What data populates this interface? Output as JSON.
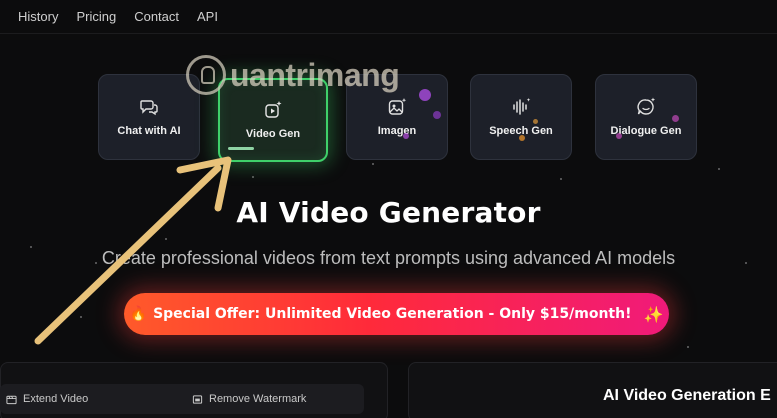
{
  "nav": {
    "items": [
      {
        "label": "History"
      },
      {
        "label": "Pricing"
      },
      {
        "label": "Contact"
      },
      {
        "label": "API"
      }
    ]
  },
  "tools": [
    {
      "label": "Chat with AI",
      "icon": "chat-bubbles-icon"
    },
    {
      "label": "Video Gen",
      "icon": "video-sparkle-icon",
      "active": true
    },
    {
      "label": "Imagen",
      "icon": "image-sparkle-icon"
    },
    {
      "label": "Speech Gen",
      "icon": "waveform-icon"
    },
    {
      "label": "Dialogue Gen",
      "icon": "dialogue-icon"
    }
  ],
  "watermark": {
    "text": "uantrimang"
  },
  "hero": {
    "title": "AI Video Generator",
    "subtitle": "Create professional videos from text prompts using advanced AI models"
  },
  "offer": {
    "label": "Special Offer: Unlimited Video Generation - Only $15/month!",
    "prefix_icon": "fire-icon",
    "suffix_icon": "sparkle-icon"
  },
  "editor_tabs": [
    {
      "label": "Extend Video",
      "icon": "film-icon"
    },
    {
      "label": "Remove Watermark",
      "icon": "watermark-icon"
    }
  ],
  "right_panel": {
    "title": "AI Video Generation E"
  },
  "colors": {
    "accent": "#3fd06a",
    "offer_start": "#ff5a2a",
    "offer_end": "#f01a7a",
    "arrow": "#e8c27a"
  }
}
